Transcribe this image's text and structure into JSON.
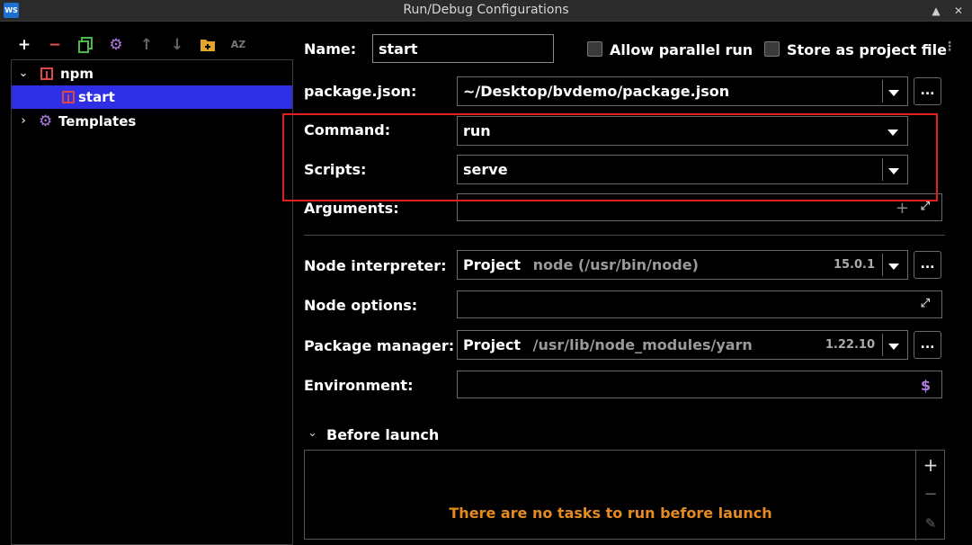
{
  "window": {
    "title": "Run/Debug Configurations",
    "app_icon": "WS",
    "controls": [
      "chevron-up-icon",
      "close-icon"
    ]
  },
  "toolbar": {
    "icons": [
      "add-icon",
      "remove-icon",
      "copy-icon",
      "gear-icon",
      "arrow-up-icon",
      "arrow-down-icon",
      "new-folder-icon",
      "sort-az-icon"
    ]
  },
  "tree": {
    "npm": "npm",
    "start": "start",
    "templates": "Templates"
  },
  "form": {
    "name_label": "Name:",
    "name_value": "start",
    "allow_parallel": "Allow parallel run",
    "store_project": "Store as project file",
    "package_label": "package.json:",
    "package_value": "~/Desktop/bvdemo/package.json",
    "command_label": "Command:",
    "command_value": "run",
    "scripts_label": "Scripts:",
    "scripts_value": "serve",
    "arguments_label": "Arguments:",
    "arguments_value": "",
    "node_interp_label": "Node interpreter:",
    "node_interp_kind": "Project",
    "node_interp_path": "node (/usr/bin/node)",
    "node_interp_version": "15.0.1",
    "node_options_label": "Node options:",
    "node_options_value": "",
    "pkg_manager_label": "Package manager:",
    "pkg_manager_kind": "Project",
    "pkg_manager_path": "/usr/lib/node_modules/yarn",
    "pkg_manager_version": "1.22.10",
    "environment_label": "Environment:",
    "environment_value": "",
    "browse_label": "..."
  },
  "before_launch": {
    "title": "Before launch",
    "empty_message": "There are no tasks to run before launch"
  },
  "colors": {
    "selection": "#2f2fe5",
    "accent_orange": "#e58a1e",
    "highlight_red": "#e02020",
    "npm_red": "#e04848",
    "gear_purple": "#b07ce0"
  }
}
